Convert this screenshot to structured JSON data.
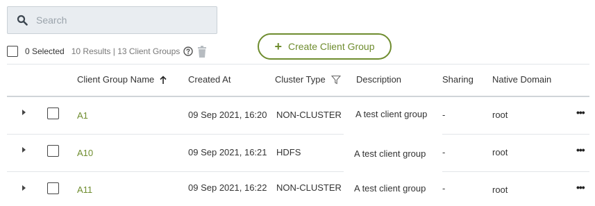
{
  "search": {
    "placeholder": "Search"
  },
  "toolbar": {
    "selected_text": "0 Selected",
    "results_text": "10 Results | 13 Client Groups"
  },
  "create_button": {
    "label": "Create Client Group"
  },
  "columns": {
    "name": "Client Group Name",
    "created": "Created At",
    "cluster": "Cluster Type",
    "description": "Description",
    "sharing": "Sharing",
    "domain": "Native Domain"
  },
  "rows": [
    {
      "name": "A1",
      "created": "09 Sep 2021, 16:20",
      "cluster": "NON-CLUSTER",
      "description": "A test client group",
      "sharing": "-",
      "domain": "root"
    },
    {
      "name": "A10",
      "created": "09 Sep 2021, 16:21",
      "cluster": "HDFS",
      "description": "A test client group",
      "sharing": "-",
      "domain": "root"
    },
    {
      "name": "A11",
      "created": "09 Sep 2021, 16:22",
      "cluster": "NON-CLUSTER",
      "description": "A test client group",
      "sharing": "-",
      "domain": "root"
    }
  ],
  "colors": {
    "accent": "#6e8c2e",
    "search_bg": "#e9edf1"
  }
}
